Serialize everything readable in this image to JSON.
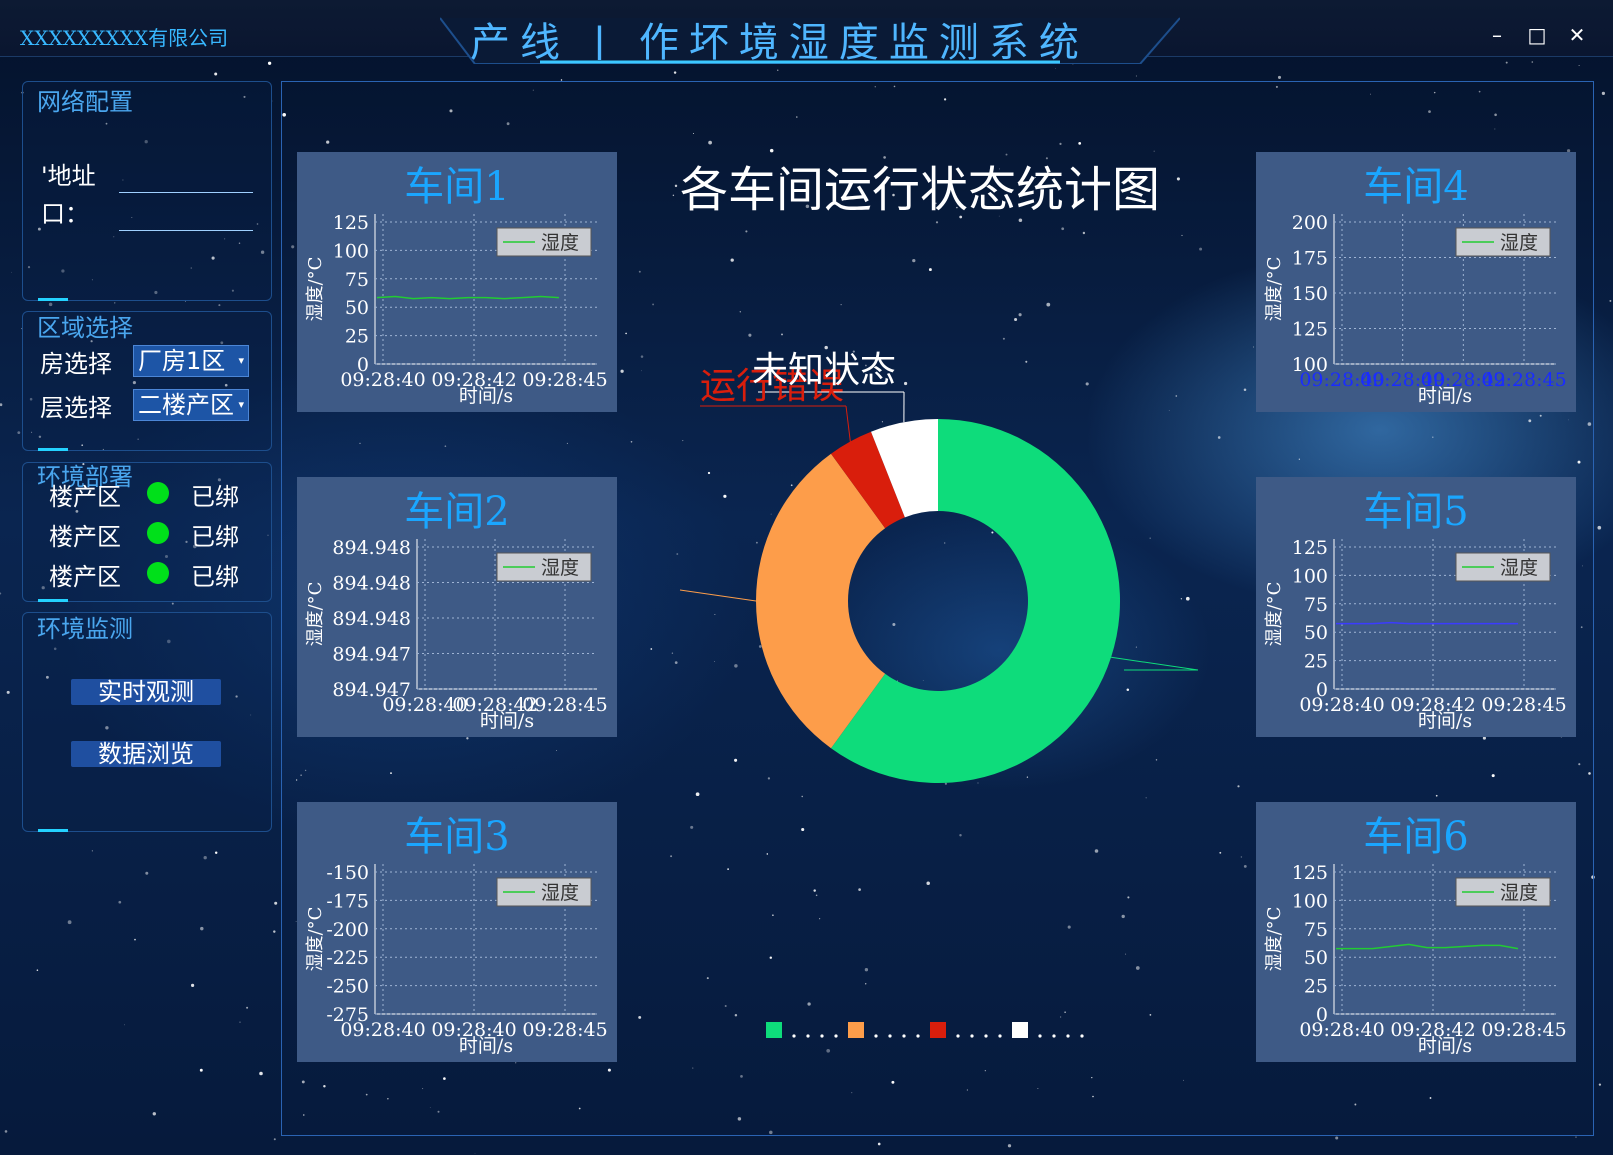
{
  "window": {
    "company": "XXXXXXXXX有限公司",
    "title": "产线 | 作坏境湿度监测系统",
    "min_icon": "minimize-icon",
    "max_icon": "maximize-icon",
    "close_icon": "close-icon"
  },
  "sidebar": {
    "network": {
      "title": "网络配置",
      "address_label": "'地址",
      "port_label": "口：",
      "address_value": "",
      "port_value": ""
    },
    "region": {
      "title": "区域选择",
      "room_label": "房选择",
      "room_value": "厂房1区",
      "floor_label": "层选择",
      "floor_value": "二楼产区"
    },
    "env_deploy": {
      "title": "环境部署",
      "rows": [
        {
          "zone": "楼产区",
          "status": "已绑",
          "color": "#00e01a"
        },
        {
          "zone": "楼产区",
          "status": "已绑",
          "color": "#00e01a"
        },
        {
          "zone": "楼产区",
          "status": "已绑",
          "color": "#00e01a"
        }
      ]
    },
    "env_monitor": {
      "title": "环境监测",
      "realtime_button": "实时观测",
      "browse_button": "数据浏览"
    }
  },
  "colors": {
    "accent": "#1aa6ff",
    "card_bg": "#3e5a86",
    "pie_running": "#0edc7b",
    "pie_stopped": "#fd9d4a",
    "pie_error": "#d91e0c",
    "pie_unknown": "#ffffff"
  },
  "chart_data": [
    {
      "type": "line",
      "title": "车间1",
      "xlabel": "时间/s",
      "ylabel": "湿度/°C",
      "x_ticks": [
        "09:28:40",
        "09:28:42",
        "09:28:45"
      ],
      "y_ticks": [
        "0",
        "25",
        "50",
        "75",
        "100",
        "125"
      ],
      "ylim": [
        0,
        140
      ],
      "legend": "湿度",
      "legend_placement": "top-right",
      "grid": true,
      "series": [
        {
          "name": "湿度",
          "color": "#22cc33",
          "x": [
            0,
            1,
            2,
            3,
            4,
            5,
            6,
            7,
            8,
            9,
            10
          ],
          "values": [
            62,
            63,
            61,
            62,
            61,
            62,
            62,
            61,
            62,
            63,
            62
          ]
        }
      ]
    },
    {
      "type": "line",
      "title": "车间2",
      "xlabel": "时间/s",
      "ylabel": "湿度/°C",
      "x_ticks": [
        "09:28:40",
        "09:28:42",
        "09:28:45"
      ],
      "y_ticks": [
        "894.947",
        "894.947",
        "894.948",
        "894.948",
        "894.948"
      ],
      "ylim": [
        894.947,
        894.948
      ],
      "legend": "湿度",
      "legend_placement": "top-right",
      "grid": true,
      "series": []
    },
    {
      "type": "line",
      "title": "车间3",
      "xlabel": "时间/s",
      "ylabel": "湿度/°C",
      "x_ticks": [
        "09:28:40",
        "09:28:40",
        "09:28:45"
      ],
      "y_ticks": [
        "-275",
        "-250",
        "-225",
        "-200",
        "-175",
        "-150"
      ],
      "ylim": [
        -280,
        -140
      ],
      "legend": "湿度",
      "legend_placement": "top-right",
      "grid": true,
      "series": []
    },
    {
      "type": "line",
      "title": "车间4",
      "xlabel": "时间/s",
      "ylabel": "湿度/°C",
      "x_ticks": [
        "09:28:40",
        "09:28:40",
        "09:28:42",
        "09:28:45"
      ],
      "x_tick_color": "#1a2cff",
      "y_ticks": [
        "100",
        "125",
        "150",
        "175",
        "200"
      ],
      "ylim": [
        75,
        215
      ],
      "legend": "湿度",
      "legend_placement": "top-right",
      "grid": true,
      "series": []
    },
    {
      "type": "line",
      "title": "车间5",
      "xlabel": "时间/s",
      "ylabel": "湿度/°C",
      "x_ticks": [
        "09:28:40",
        "09:28:42",
        "09:28:45"
      ],
      "y_ticks": [
        "0",
        "25",
        "50",
        "75",
        "100",
        "125"
      ],
      "ylim": [
        0,
        140
      ],
      "legend": "湿度",
      "legend_placement": "top-right",
      "grid": true,
      "series": [
        {
          "name": "湿度",
          "color": "#3b3bff",
          "x": [
            0,
            1,
            2,
            3,
            4,
            5,
            6,
            7,
            8,
            9,
            10
          ],
          "values": [
            61,
            61,
            61,
            62,
            61,
            61,
            61,
            61,
            61,
            61,
            61
          ]
        }
      ]
    },
    {
      "type": "line",
      "title": "车间6",
      "xlabel": "时间/s",
      "ylabel": "湿度/°C",
      "x_ticks": [
        "09:28:40",
        "09:28:42",
        "09:28:45"
      ],
      "y_ticks": [
        "0",
        "25",
        "50",
        "75",
        "100",
        "125"
      ],
      "ylim": [
        0,
        140
      ],
      "legend": "湿度",
      "legend_placement": "top-right",
      "grid": true,
      "series": [
        {
          "name": "湿度",
          "color": "#22cc33",
          "x": [
            0,
            1,
            2,
            3,
            4,
            5,
            6,
            7,
            8,
            9,
            10
          ],
          "values": [
            61,
            61,
            61,
            63,
            65,
            62,
            62,
            63,
            64,
            64,
            61
          ]
        }
      ]
    },
    {
      "type": "pie",
      "title": "各车间运行状态统计图",
      "donut": true,
      "slices": [
        {
          "label": "",
          "value": 60,
          "color": "#0edc7b"
        },
        {
          "label": "",
          "value": 30,
          "color": "#fd9d4a"
        },
        {
          "label": "运行错误",
          "value": 4,
          "color": "#d91e0c"
        },
        {
          "label": "未知状态",
          "value": 6,
          "color": "#ffffff"
        }
      ],
      "legend_markers": [
        "#0edc7b",
        "#fd9d4a",
        "#d91e0c",
        "#ffffff"
      ],
      "legend_placement": "bottom"
    }
  ]
}
